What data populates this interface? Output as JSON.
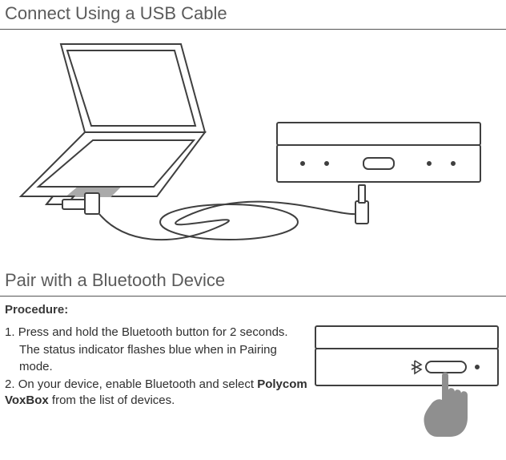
{
  "section1": {
    "title": "Connect Using a USB Cable"
  },
  "section2": {
    "title": "Pair with a Bluetooth Device",
    "procedure_label": "Procedure:",
    "steps": {
      "s1_num": "1.",
      "s1": "Press and hold the Bluetooth button for 2 seconds.",
      "s1b": "The status indicator flashes blue when in Pairing mode.",
      "s2_num": "2.",
      "s2a": "On your device, enable Bluetooth and select ",
      "s2_bold": "Polycom VoxBox",
      "s2b": " from the list of devices."
    }
  }
}
